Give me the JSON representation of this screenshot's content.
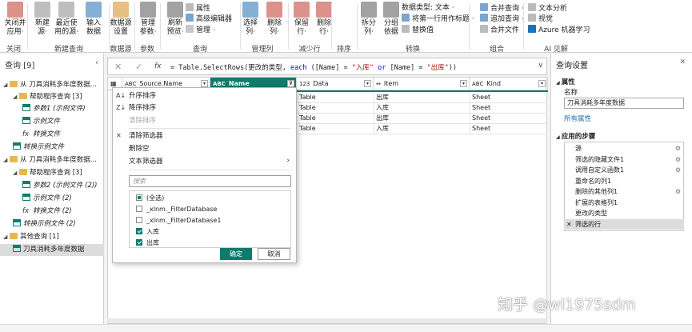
{
  "ribbon": {
    "buttons": [
      {
        "label": "关闭并\n应用·",
        "icon": "close-apply-icon",
        "color": "#c0392b"
      },
      {
        "label": "新建\n源·",
        "icon": "new-source-icon",
        "color": "#888888"
      },
      {
        "label": "最近使\n用的源·",
        "icon": "recent-sources-icon",
        "color": "#888888"
      },
      {
        "label": "输入\n数据",
        "icon": "enter-data-icon",
        "color": "#1f6fb2"
      },
      {
        "label": "数据源\n设置",
        "icon": "datasource-settings-icon",
        "color": "#d68a1e"
      },
      {
        "label": "管理\n参数·",
        "icon": "manage-params-icon",
        "color": "#555555"
      },
      {
        "label": "刷新\n预览·",
        "icon": "refresh-icon",
        "color": "#555555"
      },
      {
        "label": "选择\n列·",
        "icon": "choose-columns-icon",
        "color": "#1f6fb2"
      },
      {
        "label": "删除\n列·",
        "icon": "remove-columns-icon",
        "color": "#c0392b"
      },
      {
        "label": "保留\n行·",
        "icon": "keep-rows-icon",
        "color": "#c0392b"
      },
      {
        "label": "删除\n行·",
        "icon": "remove-rows-icon",
        "color": "#c0392b"
      },
      {
        "label": "拆分\n列·",
        "icon": "split-column-icon",
        "color": "#555555"
      },
      {
        "label": "分组\n依据",
        "icon": "group-by-icon",
        "color": "#555555"
      }
    ],
    "small": {
      "properties": "属性",
      "advanced_editor": "高级编辑器",
      "manage": "管理 ·",
      "data_type": "数据类型: 文本 ·",
      "first_row_header": "将第一行用作标题 ·",
      "replace_values": "替换值",
      "merge_queries": "合并查询 ·",
      "append_queries": "追加查询 ·",
      "combine_files": "合并文件",
      "text_analytics": "文本分析",
      "vision": "视觉",
      "azure_ml": "Azure 机器学习"
    },
    "groups": [
      "关闭",
      "新建查询",
      "数据源",
      "参数",
      "查询",
      "管理列",
      "减少行",
      "排序",
      "转换",
      "组合",
      "AI 见解"
    ]
  },
  "queries": {
    "header": "查询 [9]",
    "collapse": "‹",
    "items": [
      {
        "label": "从 刀具消耗多年度数据...",
        "type": "folder",
        "indent": 0,
        "italic": false
      },
      {
        "label": "帮助程序查询 [3]",
        "type": "folder",
        "indent": 1,
        "italic": false
      },
      {
        "label": "参数1 (示例文件)",
        "type": "table",
        "indent": 2,
        "italic": true
      },
      {
        "label": "示例文件",
        "type": "table",
        "indent": 2,
        "italic": true
      },
      {
        "label": "转换文件",
        "type": "fx",
        "indent": 2,
        "italic": true
      },
      {
        "label": "转换示例文件",
        "type": "table",
        "indent": 1,
        "italic": true
      },
      {
        "label": "从 刀具消耗多年度数据...",
        "type": "folder",
        "indent": 0,
        "italic": false
      },
      {
        "label": "帮助程序查询 [3]",
        "type": "folder",
        "indent": 1,
        "italic": false
      },
      {
        "label": "参数2 (示例文件 (2))",
        "type": "table",
        "indent": 2,
        "italic": true
      },
      {
        "label": "示例文件 (2)",
        "type": "table",
        "indent": 2,
        "italic": true
      },
      {
        "label": "转换文件 (2)",
        "type": "fx",
        "indent": 2,
        "italic": true
      },
      {
        "label": "转换示例文件 (2)",
        "type": "table",
        "indent": 1,
        "italic": true
      },
      {
        "label": "其他查询 [1]",
        "type": "folder",
        "indent": 0,
        "italic": false
      },
      {
        "label": "刀具消耗多年度数据",
        "type": "table",
        "indent": 1,
        "italic": false,
        "selected": true
      }
    ]
  },
  "formula": {
    "cancel": "✕",
    "confirm": "✓",
    "fx": "fx",
    "parts": [
      {
        "t": "= Table.SelectRows(更改的类型, ",
        "c": ""
      },
      {
        "t": "each",
        "c": "k"
      },
      {
        "t": " ([Name] = ",
        "c": ""
      },
      {
        "t": "\"入库\"",
        "c": "s"
      },
      {
        "t": " ",
        "c": ""
      },
      {
        "t": "or",
        "c": "k"
      },
      {
        "t": " [Name] = ",
        "c": ""
      },
      {
        "t": "\"出库\"",
        "c": "s"
      },
      {
        "t": "))",
        "c": ""
      }
    ],
    "dropdown": "∨"
  },
  "grid": {
    "columns": [
      {
        "name": "Source.Name",
        "type": "ABC"
      },
      {
        "name": "Name",
        "type": "ABC"
      },
      {
        "name": "Data",
        "type": "123"
      },
      {
        "name": "Item",
        "type": "↔"
      },
      {
        "name": "Kind",
        "type": "ABC"
      }
    ],
    "rows": [
      [
        "Table",
        "出库",
        "Sheet"
      ],
      [
        "Table",
        "入库",
        "Sheet"
      ],
      [
        "Table",
        "出库",
        "Sheet"
      ],
      [
        "Table",
        "入库",
        "Sheet"
      ]
    ]
  },
  "filter_menu": {
    "items": [
      {
        "label": "升序排序",
        "icon": "sort-asc-icon",
        "glyph": "A↓",
        "disabled": false
      },
      {
        "label": "降序排序",
        "icon": "sort-desc-icon",
        "glyph": "Z↓",
        "disabled": false
      },
      {
        "label": "清除排序",
        "icon": "",
        "glyph": "",
        "disabled": true
      },
      {
        "label": "清除筛选器",
        "icon": "clear-filter-icon",
        "glyph": "✕",
        "disabled": false
      },
      {
        "label": "删除空",
        "icon": "",
        "glyph": "",
        "disabled": false
      },
      {
        "label": "文本筛选器",
        "icon": "",
        "glyph": "",
        "disabled": false
      }
    ],
    "submenu_arrow": "›",
    "search_placeholder": "搜索",
    "checkboxes": [
      {
        "label": "(全选)",
        "state": "partial"
      },
      {
        "label": "_xlnm._FilterDatabase",
        "state": "off"
      },
      {
        "label": "_xlnm._FilterDatabase1",
        "state": "off"
      },
      {
        "label": "入库",
        "state": "on"
      },
      {
        "label": "出库",
        "state": "on"
      }
    ],
    "ok": "确定",
    "cancel": "取消"
  },
  "settings": {
    "title": "查询设置",
    "close": "✕",
    "properties_header": "属性",
    "name_label": "名称",
    "name_value": "刀具消耗多年度数据",
    "all_properties": "所有属性",
    "steps_header": "应用的步骤",
    "steps": [
      {
        "label": "源",
        "gear": true
      },
      {
        "label": "筛选的隐藏文件1",
        "gear": true
      },
      {
        "label": "调用自定义函数1",
        "gear": true
      },
      {
        "label": "重命名的列1",
        "gear": false
      },
      {
        "label": "删除的其他列1",
        "gear": true
      },
      {
        "label": "扩展的表格列1",
        "gear": false
      },
      {
        "label": "更改的类型",
        "gear": false
      },
      {
        "label": "筛选的行",
        "gear": false,
        "selected": true
      }
    ]
  },
  "watermark": "知乎 @wl1975sdm",
  "colors": {
    "accent": "#0f7b6c",
    "folder": "#e6b84d"
  }
}
